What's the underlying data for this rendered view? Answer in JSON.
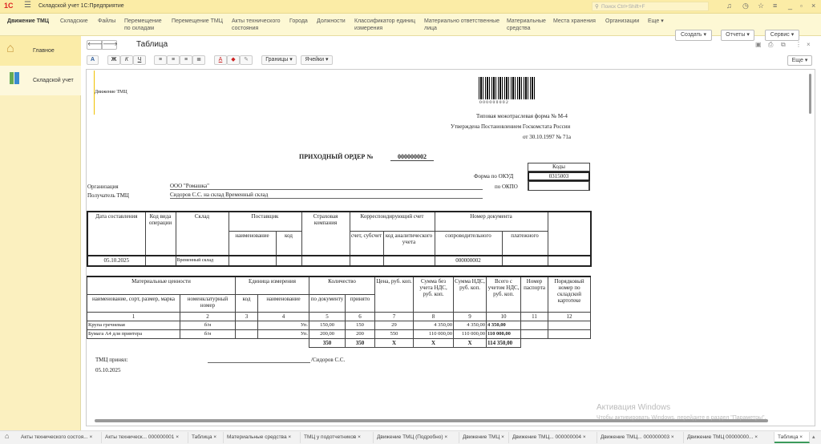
{
  "app": {
    "title": "Складской учет 1С:Предприятие",
    "search_placeholder": "Поиск Ctrl+Shift+F"
  },
  "nav": {
    "items": [
      "Движение ТМЦ",
      "Складские",
      "Файлы",
      "Перемещение по складам",
      "Перемещение ТМЦ",
      "Акты технического состояния",
      "Города",
      "Должности",
      "Классификатор единиц измерения",
      "Материально ответственные лица",
      "Материальные средства",
      "Места хранения",
      "Организации",
      "Еще ▾"
    ],
    "create": "Создать ▾",
    "reports": "Отчеты ▾",
    "service": "Сервис ▾"
  },
  "sidebar": {
    "items": [
      {
        "label": "Главное"
      },
      {
        "label": "Складской учет"
      }
    ]
  },
  "form": {
    "title": "Таблица",
    "more": "Еще ▾",
    "borders": "Границы ▾",
    "cells": "Ячейки ▾",
    "fmt": {
      "font": "A",
      "bold": "Ж",
      "italic": "К",
      "underline": "Ч"
    }
  },
  "doc": {
    "corner_label": "Движение ТМЦ",
    "barcode_text": "0 0 0 0 0 0 0 0 2",
    "form_type": "Типовая межотраслевая форма № М-4",
    "approved": "Утверждена Постановлением Госкомстата России",
    "approved_date": "от 30.10.1997 № 71а",
    "title": "ПРИХОДНЫЙ ОРДЕР №",
    "number": "000000002",
    "codes_label": "Коды",
    "okud_label": "Форма по ОКУД",
    "okud": "0315003",
    "okpo_label": "по ОКПО",
    "okpo": "",
    "org_label": "Организация",
    "org": "ООО \"Ромашка\"",
    "recipient_label": "Получатель ТМЦ",
    "recipient": "Сидоров С.С. на склад Временный склад",
    "table1": {
      "h": [
        "Дата составления",
        "Код вида операции",
        "Склад",
        "Поставщик",
        "Страховая компания",
        "Корреспондирующий счет",
        "Номер документа",
        "наименование",
        "код",
        "счет, субсчет",
        "код аналитического учета",
        "сопроводительного",
        "платежного"
      ],
      "row": [
        "05.10.2025",
        "",
        "Временный склад",
        "",
        "",
        "",
        "",
        "",
        "000000002",
        "",
        ""
      ]
    },
    "table2": {
      "h": [
        "Материальные ценности",
        "Единица измерения",
        "Количество",
        "Цена, руб. коп.",
        "Сумма без учета НДС, руб. коп.",
        "Сумма НДС, руб. коп.",
        "Всего с учетом НДС, руб. коп.",
        "Номер паспорта",
        "Порядковый номер по складской картотеке",
        "наименование, сорт, размер, марка",
        "номенклатурный номер",
        "код",
        "наименование",
        "по документу",
        "принято"
      ],
      "nums": [
        "1",
        "2",
        "3",
        "4",
        "5",
        "6",
        "7",
        "8",
        "9",
        "10",
        "11",
        "12"
      ],
      "rows": [
        [
          "Крупа гречневая",
          "б/н",
          "",
          "Уп.",
          "150,00",
          "150",
          "29",
          "4 350,00",
          "4 350,00",
          "4 350,00",
          "",
          ""
        ],
        [
          "Бумага А4 для принтера",
          "б/н",
          "",
          "Уп.",
          "200,00",
          "200",
          "550",
          "110 000,00",
          "110 000,00",
          "110 000,00",
          "",
          ""
        ]
      ],
      "totals": [
        "350",
        "350",
        "Х",
        "Х",
        "Х",
        "114 350,00"
      ]
    },
    "accepted_label": "ТМЦ принял:",
    "accepted_by": "/Сидоров С.С.",
    "date": "05.10.2025"
  },
  "watermark": {
    "line1": "Активация Windows",
    "line2": "Чтобы активировать Windows, перейдите в раздел \"Параметры\"."
  },
  "tabs": [
    "Акты технического состоя...",
    "Акты техническ... 000000001",
    "Таблица",
    "Материальные средства",
    "ТМЦ у подотчетников",
    "Движение ТМЦ (Подробно)",
    "Движение ТМЦ",
    "Движение ТМЦ... 000000004",
    "Движение ТМЦ... 000000003",
    "Движение ТМЦ 00000000...",
    "Таблица"
  ]
}
